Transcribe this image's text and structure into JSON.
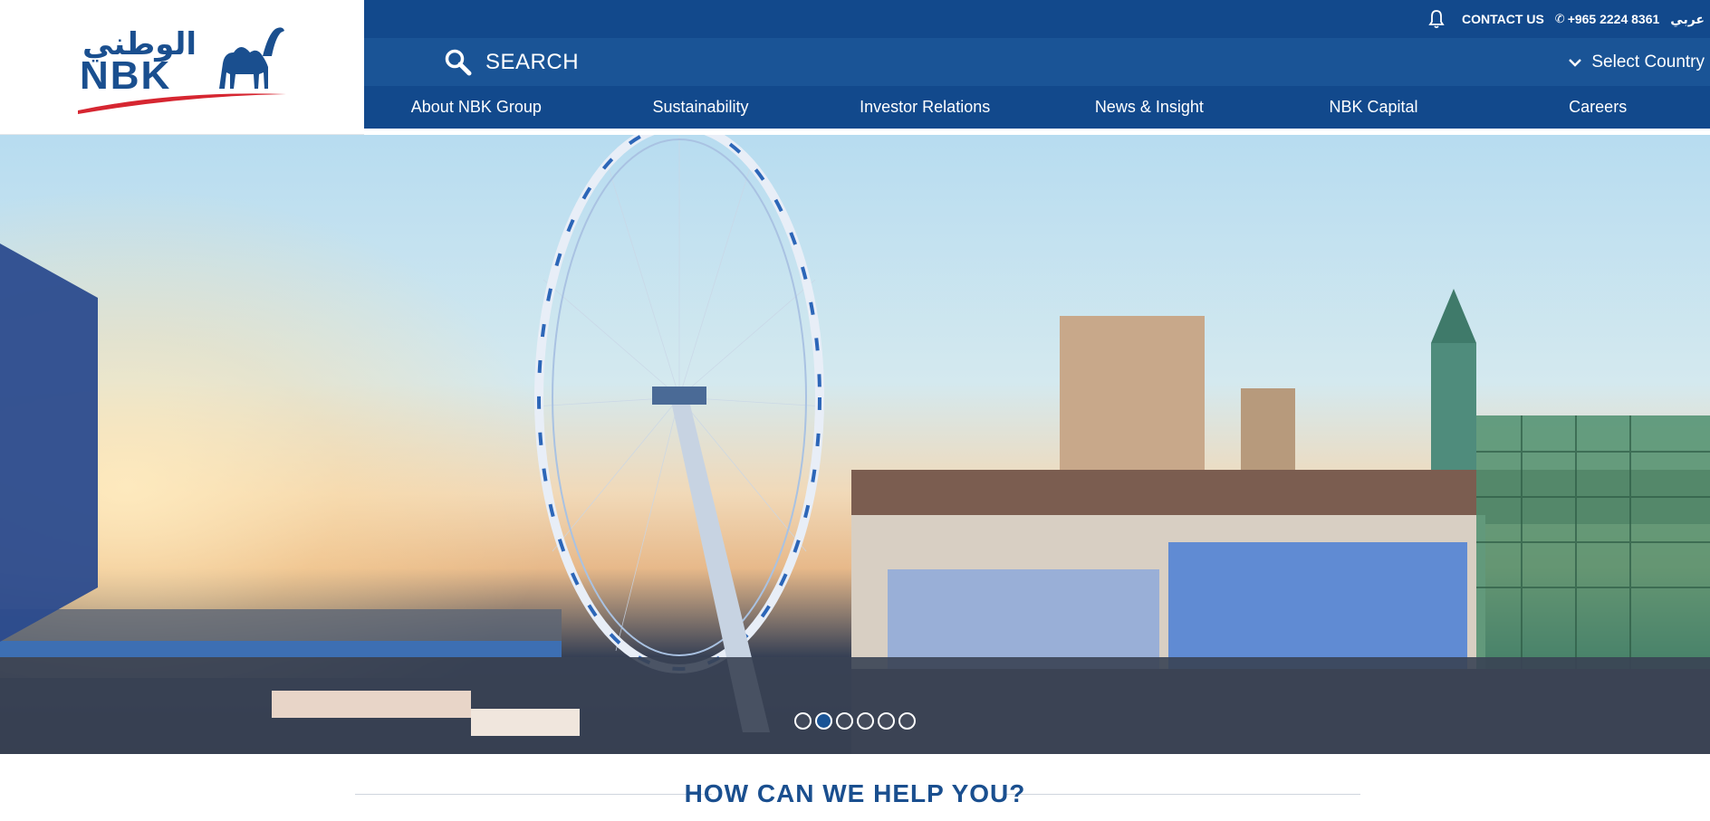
{
  "brand": {
    "name": "NBK",
    "arabic_name": "الوطني"
  },
  "topbar": {
    "contact_label": "CONTACT US",
    "phone": "+965 2224 8361",
    "language_label": "عربي"
  },
  "search": {
    "label": "SEARCH"
  },
  "country_select": {
    "label": "Select Country"
  },
  "nav": {
    "items": [
      {
        "label": "About NBK Group"
      },
      {
        "label": "Sustainability"
      },
      {
        "label": "Investor Relations"
      },
      {
        "label": "News & Insight"
      },
      {
        "label": "NBK Capital"
      },
      {
        "label": "Careers"
      }
    ]
  },
  "slider": {
    "slide_count": 6,
    "active_index": 1
  },
  "help": {
    "title": "HOW CAN WE HELP YOU?"
  },
  "colors": {
    "primary": "#12498c",
    "search_bar": "#1a5496",
    "accent_red": "#d62631"
  }
}
